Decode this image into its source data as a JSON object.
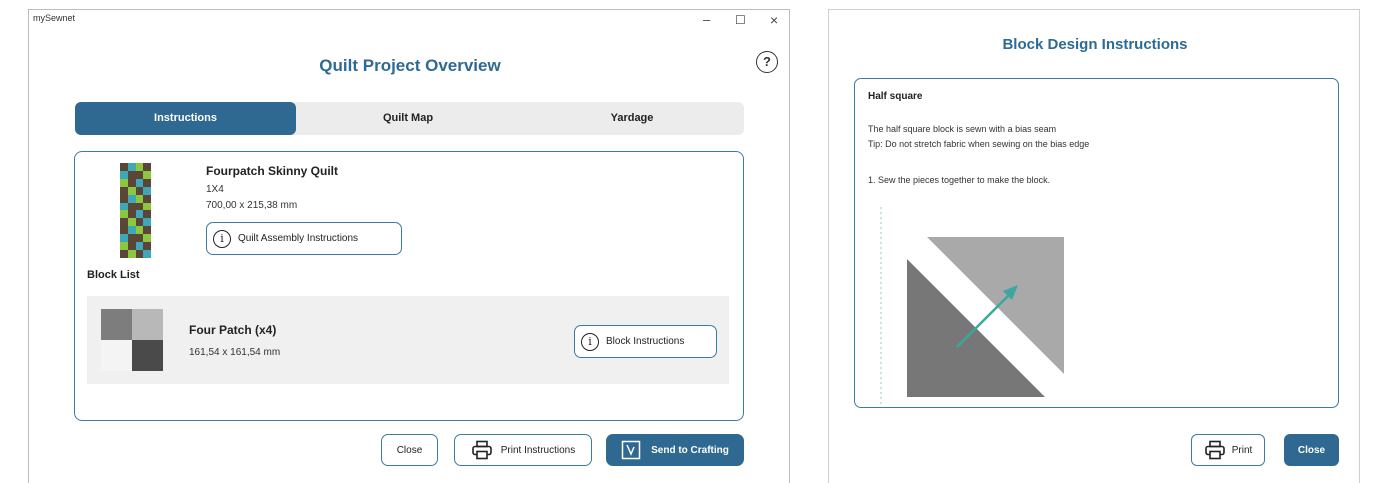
{
  "left_window": {
    "app_title": "mySewnet",
    "window_controls": {
      "minimize": "–",
      "maximize": "☐",
      "close": "×"
    },
    "page_title": "Quilt Project Overview",
    "help_symbol": "?",
    "tabs": [
      {
        "label": "Instructions",
        "active": true
      },
      {
        "label": "Quilt Map",
        "active": false
      },
      {
        "label": "Yardage",
        "active": false
      }
    ],
    "quilt": {
      "title": "Fourpatch Skinny Quilt",
      "layout": "1X4",
      "size": "700,00 x 215,38 mm",
      "assembly_button": "Quilt Assembly Instructions"
    },
    "block_list_label": "Block List",
    "blocks": [
      {
        "title": "Four Patch (x4)",
        "size": "161,54 x 161,54 mm",
        "button": "Block Instructions"
      }
    ],
    "footer": {
      "close": "Close",
      "print": "Print Instructions",
      "send": "Send to Crafting"
    },
    "colors": {
      "accent": "#2f6890",
      "title": "#2d6b94",
      "border": "#3c7aa6"
    }
  },
  "right_window": {
    "title": "Block Design Instructions",
    "heading": "Half square",
    "lines": [
      "The half square block is sewn with a bias seam",
      "Tip: Do not stretch fabric when sewing on the bias edge",
      "1. Sew the pieces together to make the block."
    ],
    "footer": {
      "print": "Print",
      "close": "Close"
    },
    "colors": {
      "arrow": "#3aa7a0",
      "dark_triangle": "#777777",
      "light_triangle": "#a9a9a9"
    }
  }
}
